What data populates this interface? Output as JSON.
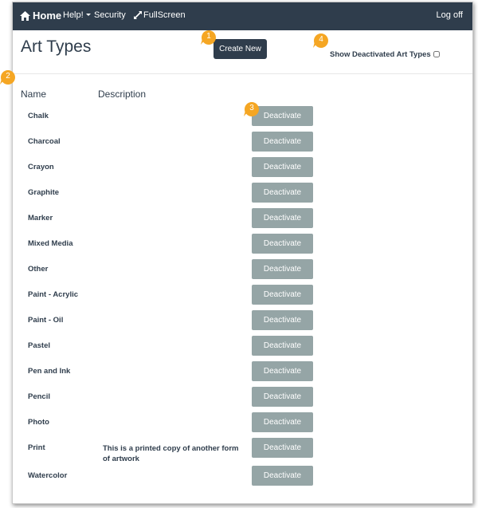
{
  "navbar": {
    "home_label": "Home",
    "help_label": "Help!",
    "security_label": "Security",
    "fullscreen_label": "FullScreen",
    "logoff_label": "Log off"
  },
  "page": {
    "title": "Art Types",
    "create_new_label": "Create New",
    "show_deactivated_label": "Show Deactivated Art Types",
    "show_deactivated_checked": false
  },
  "table": {
    "columns": [
      "Name",
      "Description"
    ],
    "action_label": "Deactivate",
    "rows": [
      {
        "name": "Chalk",
        "description": ""
      },
      {
        "name": "Charcoal",
        "description": ""
      },
      {
        "name": "Crayon",
        "description": ""
      },
      {
        "name": "Graphite",
        "description": ""
      },
      {
        "name": "Marker",
        "description": ""
      },
      {
        "name": "Mixed Media",
        "description": ""
      },
      {
        "name": "Other",
        "description": ""
      },
      {
        "name": "Paint - Acrylic",
        "description": ""
      },
      {
        "name": "Paint - Oil",
        "description": ""
      },
      {
        "name": "Pastel",
        "description": ""
      },
      {
        "name": "Pen and Ink",
        "description": ""
      },
      {
        "name": "Pencil",
        "description": ""
      },
      {
        "name": "Photo",
        "description": ""
      },
      {
        "name": "Print",
        "description": "This is a printed copy of another form of artwork"
      },
      {
        "name": "Watercolor",
        "description": ""
      }
    ]
  },
  "callouts": [
    "1",
    "2",
    "3",
    "4"
  ],
  "colors": {
    "navbar_bg": "#2f3d4c",
    "deactivate_button": "#95a5a6",
    "callout": "#f5a623"
  }
}
